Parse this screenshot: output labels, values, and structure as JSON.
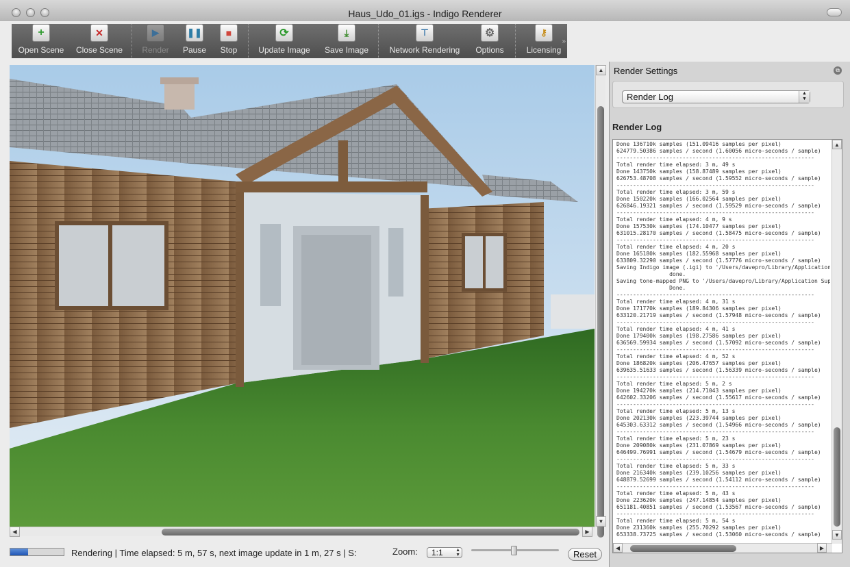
{
  "window": {
    "title": "Haus_Udo_01.igs - Indigo Renderer"
  },
  "toolbar": {
    "items": [
      {
        "label": "Open Scene",
        "icon": "plus-icon"
      },
      {
        "label": "Close Scene",
        "icon": "x-icon"
      },
      {
        "label": "Render",
        "icon": "play-icon",
        "disabled": true
      },
      {
        "label": "Pause",
        "icon": "pause-icon"
      },
      {
        "label": "Stop",
        "icon": "stop-icon"
      },
      {
        "label": "Update Image",
        "icon": "refresh-icon"
      },
      {
        "label": "Save Image",
        "icon": "download-icon"
      },
      {
        "label": "Network Rendering",
        "icon": "network-icon"
      },
      {
        "label": "Options",
        "icon": "gear-icon"
      },
      {
        "label": "Licensing",
        "icon": "key-icon"
      }
    ],
    "overflow": "»"
  },
  "statusbar": {
    "progress": 0.33,
    "text": "Rendering | Time elapsed: 5 m, 57 s, next image update in 1 m, 27 s | S:",
    "zoom_label": "Zoom:",
    "zoom_value": "1:1",
    "reset_label": "Reset"
  },
  "panel": {
    "title": "Render Settings",
    "selected_view": "Render Log",
    "log_heading": "Render Log",
    "log_lines": [
      "Done 136710k samples (151.09416 samples per pixel)",
      "624779.50386 samples / second (1.60056 micro-seconds / sample)",
      "------------------------------------------------------------",
      "Total render time elapsed: 3 m, 49 s",
      "Done 143750k samples (158.87489 samples per pixel)",
      "626753.48708 samples / second (1.59552 micro-seconds / sample)",
      "------------------------------------------------------------",
      "Total render time elapsed: 3 m, 59 s",
      "Done 150220k samples (166.02564 samples per pixel)",
      "626846.19321 samples / second (1.59529 micro-seconds / sample)",
      "------------------------------------------------------------",
      "Total render time elapsed: 4 m, 9 s",
      "Done 157530k samples (174.10477 samples per pixel)",
      "631015.28170 samples / second (1.58475 micro-seconds / sample)",
      "------------------------------------------------------------",
      "Total render time elapsed: 4 m, 20 s",
      "Done 165180k samples (182.55968 samples per pixel)",
      "633809.32290 samples / second (1.57776 micro-seconds / sample)",
      "Saving Indigo image (.igi) to '/Users/davepro/Library/Application",
      "                done.",
      "Saving tone-mapped PNG to '/Users/davepro/Library/Application Supp",
      "                Done.",
      "------------------------------------------------------------",
      "Total render time elapsed: 4 m, 31 s",
      "Done 171770k samples (189.84306 samples per pixel)",
      "633120.21719 samples / second (1.57948 micro-seconds / sample)",
      "------------------------------------------------------------",
      "Total render time elapsed: 4 m, 41 s",
      "Done 179400k samples (198.27586 samples per pixel)",
      "636569.59934 samples / second (1.57092 micro-seconds / sample)",
      "------------------------------------------------------------",
      "Total render time elapsed: 4 m, 52 s",
      "Done 186820k samples (206.47657 samples per pixel)",
      "639635.51633 samples / second (1.56339 micro-seconds / sample)",
      "------------------------------------------------------------",
      "Total render time elapsed: 5 m, 2 s",
      "Done 194270k samples (214.71043 samples per pixel)",
      "642602.33206 samples / second (1.55617 micro-seconds / sample)",
      "------------------------------------------------------------",
      "Total render time elapsed: 5 m, 13 s",
      "Done 202130k samples (223.39744 samples per pixel)",
      "645303.63312 samples / second (1.54966 micro-seconds / sample)",
      "------------------------------------------------------------",
      "Total render time elapsed: 5 m, 23 s",
      "Done 209080k samples (231.07869 samples per pixel)",
      "646499.76991 samples / second (1.54679 micro-seconds / sample)",
      "------------------------------------------------------------",
      "Total render time elapsed: 5 m, 33 s",
      "Done 216340k samples (239.10256 samples per pixel)",
      "648879.52699 samples / second (1.54112 micro-seconds / sample)",
      "------------------------------------------------------------",
      "Total render time elapsed: 5 m, 43 s",
      "Done 223620k samples (247.14854 samples per pixel)",
      "651181.40851 samples / second (1.53567 micro-seconds / sample)",
      "------------------------------------------------------------",
      "Total render time elapsed: 5 m, 54 s",
      "Done 231360k samples (255.70292 samples per pixel)",
      "653338.73725 samples / second (1.53060 micro-seconds / sample)"
    ]
  },
  "colors": {
    "toolbar_bg": "#5e5e5e",
    "progress_fill": "#2a5fbf",
    "sky": "#b8d3ea",
    "grass": "#3f7a2a",
    "wood": "#8a6a4a",
    "roof": "#9aa0a6"
  }
}
